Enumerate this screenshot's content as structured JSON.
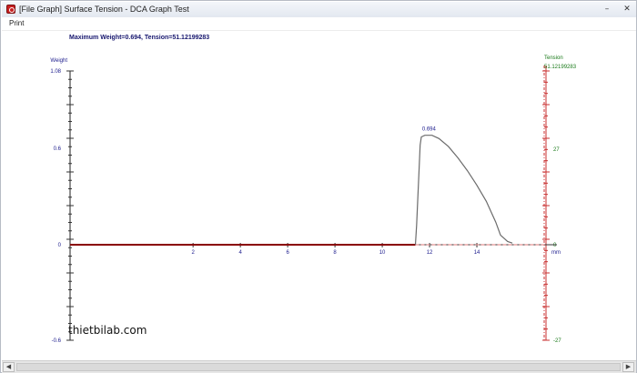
{
  "window": {
    "title": "[File Graph] Surface Tension - DCA Graph Test",
    "controls": {
      "minimize": "–",
      "close": "✕"
    }
  },
  "menu": {
    "items": [
      {
        "label": "Print"
      }
    ]
  },
  "summary": "Maximum Weight=0.694, Tension=51.12199283",
  "watermark": "thietbilab.com",
  "colors": {
    "left_axis": "#1a1a8c",
    "right_axis": "#c83030",
    "right_labels": "#1a7a1a",
    "baseline": "#8a0000",
    "curve": "#6b6b6b"
  },
  "chart_data": {
    "type": "line",
    "left_axis": {
      "label": "Weight",
      "ticks": [
        "1.08",
        "0.6",
        "0",
        "-0.6"
      ],
      "ylim": [
        -0.6,
        1.08
      ]
    },
    "right_axis": {
      "label": "Tension",
      "top_value": "51.12199283",
      "ticks": [
        "27",
        "0",
        "-27"
      ]
    },
    "x_axis": {
      "unit": "mm",
      "ticks": [
        "2",
        "4",
        "6",
        "8",
        "10",
        "12",
        "14"
      ],
      "xlim": [
        -3.2,
        17.5
      ]
    },
    "peak_label": "0.694",
    "series": [
      {
        "x": [
          -3.2,
          11.4,
          11.45,
          11.55,
          11.6,
          11.65,
          11.8,
          12.1,
          12.4,
          12.8,
          13.2,
          13.6,
          14.0,
          14.4,
          14.8,
          15.0,
          15.3,
          15.5
        ],
        "y": [
          0,
          0,
          0.12,
          0.45,
          0.62,
          0.67,
          0.68,
          0.68,
          0.66,
          0.61,
          0.54,
          0.46,
          0.37,
          0.27,
          0.14,
          0.06,
          0.02,
          0.01
        ]
      }
    ]
  }
}
